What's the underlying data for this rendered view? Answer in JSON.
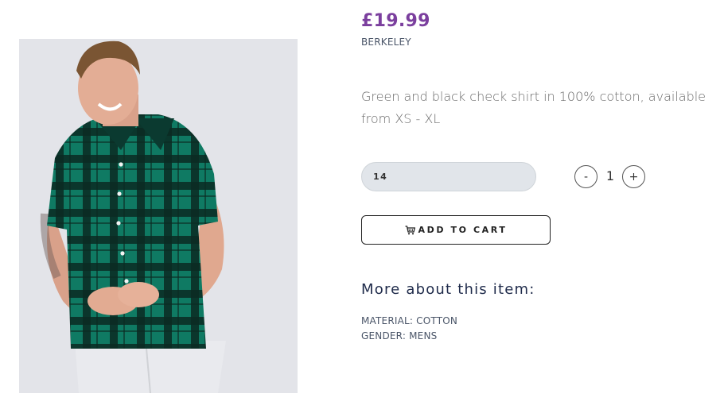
{
  "product": {
    "price": "£19.99",
    "brand": "BERKELEY",
    "description": "Green and black check shirt in 100% cotton, available from XS - XL",
    "image_alt": "Man wearing green and black check shirt"
  },
  "size_field": {
    "value": "14"
  },
  "quantity": {
    "minus_label": "-",
    "value": "1",
    "plus_label": "+"
  },
  "add_to_cart": {
    "label": "ADD TO CART",
    "icon": "shopping-cart-icon"
  },
  "more": {
    "heading": "More about this item:",
    "material": "MATERIAL: COTTON",
    "gender": "GENDER: MENS"
  },
  "colors": {
    "price": "#7b3f9e",
    "shirt_green": "#0f7a63",
    "shirt_dark": "#0b2a22",
    "image_bg": "#e3e4e9"
  }
}
